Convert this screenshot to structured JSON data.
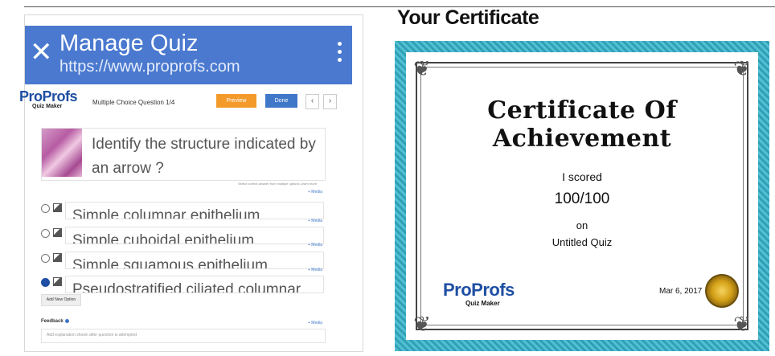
{
  "left": {
    "appbar": {
      "close_icon": "close-icon",
      "title": "Manage Quiz",
      "url": "https://www.proprofs.com",
      "menu_icon": "more-vert-icon"
    },
    "toolbar": {
      "logo_main": "ProProfs",
      "logo_sub": "Quiz Maker",
      "question_number": "Multiple Choice Question 1/4",
      "preview_label": "Preview",
      "done_label": "Done",
      "prev_arrow": "‹",
      "next_arrow": "›"
    },
    "question": {
      "text": "Identify the structure indicated by an arrow ?",
      "hint": "Select correct answer from multiple options   Learn more"
    },
    "media_label": "+ Media",
    "options": [
      {
        "text": "Simple columnar epithelium",
        "selected": false
      },
      {
        "text": "Simple cuboidal epithelium",
        "selected": false
      },
      {
        "text": "Simple squamous epithelium",
        "selected": false
      },
      {
        "text": "Pseudostratified ciliated columnar",
        "selected": true
      }
    ],
    "add_option_label": "Add New Option",
    "feedback_label": "Feedback",
    "feedback_placeholder": "Add explanation shown after question is attempted"
  },
  "right": {
    "heading": "Your Certificate",
    "certificate": {
      "title": "Certificate Of Achievement",
      "scored_label": "I scored",
      "score": "100/100",
      "on_label": "on",
      "quiz_name": "Untitled Quiz",
      "logo_main": "ProProfs",
      "logo_sub": "Quiz Maker",
      "date": "Mar 6, 2017"
    },
    "colors": {
      "frame": "#2ea1b8",
      "accent": "#1f4fa3"
    }
  }
}
